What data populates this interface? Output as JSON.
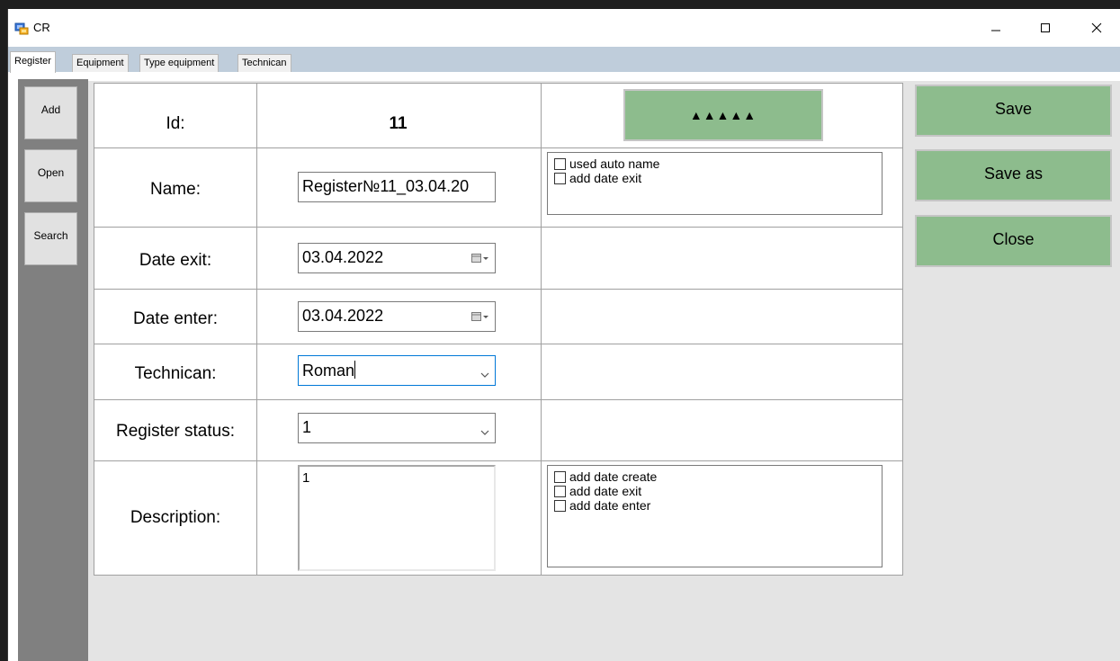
{
  "window": {
    "title": "CR",
    "minimize_glyph": "—",
    "maximize_icon": "maximize-icon",
    "close_icon": "close-icon"
  },
  "tabs": [
    {
      "label": "Register",
      "active": true
    },
    {
      "label": "Equipment",
      "active": false
    },
    {
      "label": "Type equipment",
      "active": false
    },
    {
      "label": "Technican",
      "active": false
    }
  ],
  "sidebar": {
    "buttons": [
      {
        "label": "Add"
      },
      {
        "label": "Open"
      },
      {
        "label": "Search"
      }
    ]
  },
  "form": {
    "id_label": "Id:",
    "id_value": "11",
    "generate_button_label": "▲▲▲▲▲",
    "name_label": "Name:",
    "name_value": "Register№11_03.04.20",
    "name_options": [
      {
        "label": "used auto name",
        "checked": false
      },
      {
        "label": "add date exit",
        "checked": false
      }
    ],
    "date_exit_label": "Date exit:",
    "date_exit_value": "03.04.2022",
    "date_enter_label": "Date enter:",
    "date_enter_value": "03.04.2022",
    "technican_label": "Technican:",
    "technican_value": "Roman",
    "register_status_label": "Register status:",
    "register_status_value": "1",
    "description_label": "Description:",
    "description_value": "1",
    "description_options": [
      {
        "label": "add date create",
        "checked": false
      },
      {
        "label": "add date exit",
        "checked": false
      },
      {
        "label": "add date enter",
        "checked": false
      }
    ]
  },
  "actions": {
    "save_label": "Save",
    "save_as_label": "Save as",
    "close_label": "Close"
  },
  "colors": {
    "button_green": "#8dbc8d",
    "tabstrip_blue": "#bfcddb",
    "sidebar_gray": "#808080",
    "focus_blue": "#0078d7"
  }
}
